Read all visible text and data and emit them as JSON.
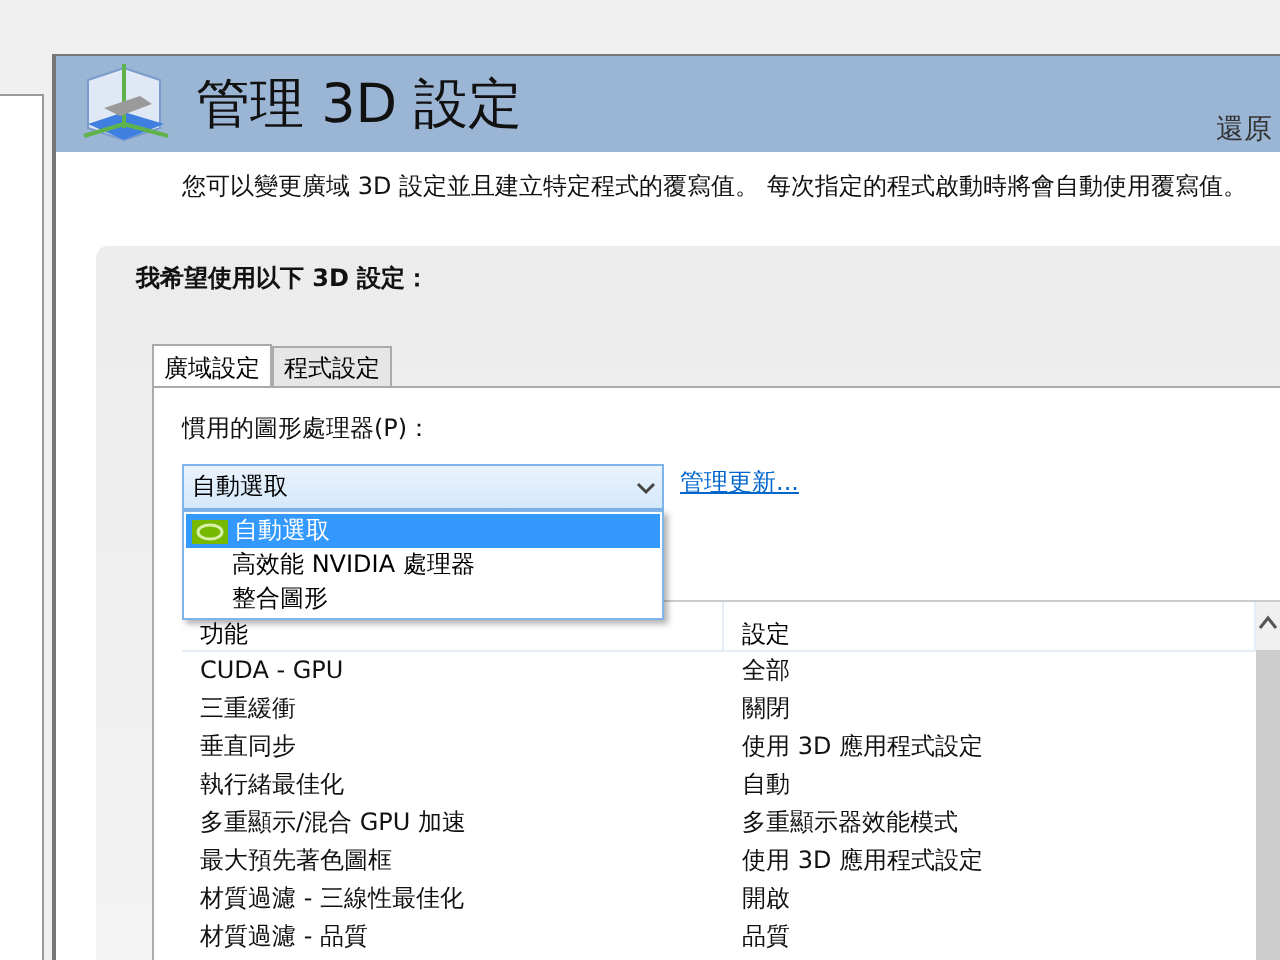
{
  "page": {
    "title": "管理 3D 設定",
    "restore_link": "還原",
    "description": "您可以變更廣域 3D 設定並且建立特定程式的覆寫值。 每次指定的程式啟動時將會自動使用覆寫值。"
  },
  "settings": {
    "heading": "我希望使用以下 3D 設定：",
    "tabs": [
      {
        "label": "廣域設定",
        "selected": true
      },
      {
        "label": "程式設定",
        "selected": false
      }
    ],
    "processor_label": "慣用的圖形處理器(P)：",
    "processor_select": {
      "value": "自動選取",
      "expanded": true
    },
    "manage_link": "管理更新...",
    "dropdown_options": [
      {
        "label": "自動選取",
        "selected": true,
        "kind": "nvidia"
      },
      {
        "label": "高效能 NVIDIA 處理器",
        "selected": false,
        "kind": "plain"
      },
      {
        "label": "整合圖形",
        "selected": false,
        "kind": "plain"
      }
    ],
    "table": {
      "columns": [
        "功能",
        "設定"
      ],
      "rows": [
        [
          "CUDA - GPU",
          "全部"
        ],
        [
          "三重緩衝",
          "關閉"
        ],
        [
          "垂直同步",
          "使用 3D 應用程式設定"
        ],
        [
          "執行緒最佳化",
          "自動"
        ],
        [
          "多重顯示/混合 GPU 加速",
          "多重顯示器效能模式"
        ],
        [
          "最大預先著色圖框",
          "使用 3D 應用程式設定"
        ],
        [
          "材質過濾 - 三線性最佳化",
          "開啟"
        ],
        [
          "材質過濾 - 品質",
          "品質"
        ]
      ]
    }
  }
}
